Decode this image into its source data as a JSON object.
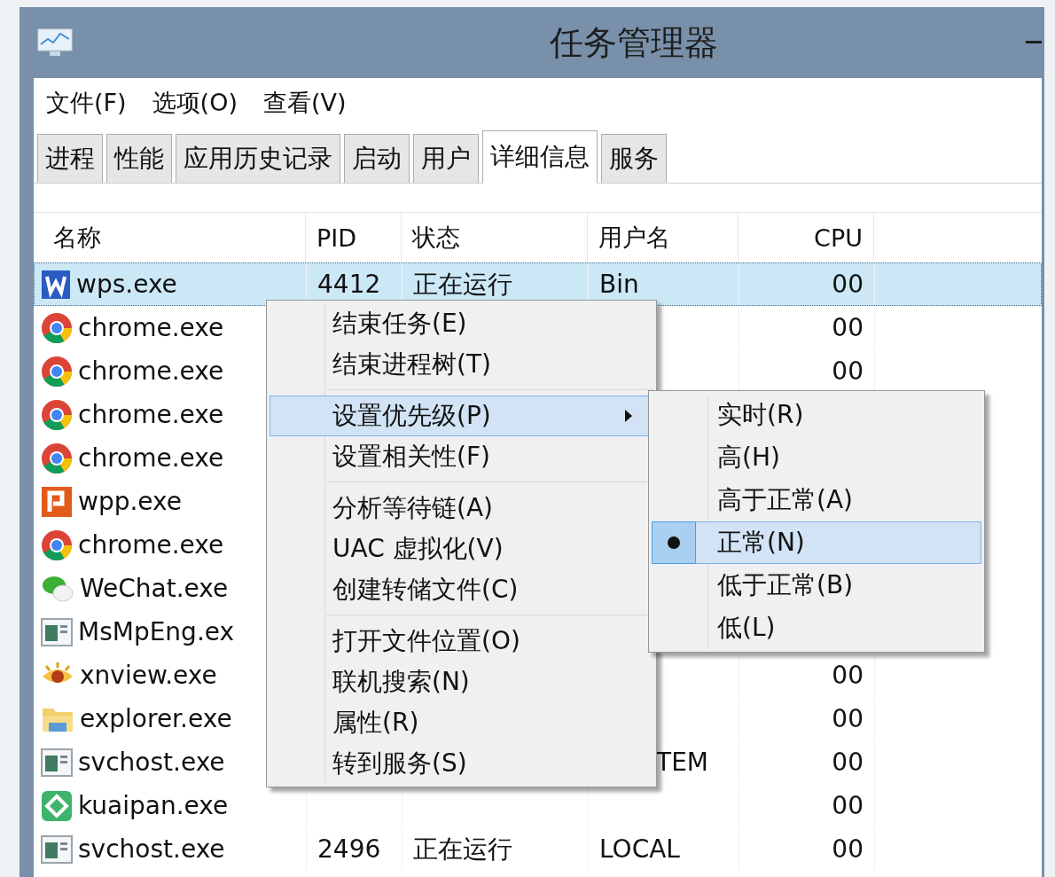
{
  "window": {
    "title": "任务管理器"
  },
  "menu_bar": [
    "文件(F)",
    "选项(O)",
    "查看(V)"
  ],
  "tabs": [
    {
      "label": "进程",
      "selected": false
    },
    {
      "label": "性能",
      "selected": false
    },
    {
      "label": "应用历史记录",
      "selected": false
    },
    {
      "label": "启动",
      "selected": false
    },
    {
      "label": "用户",
      "selected": false
    },
    {
      "label": "详细信息",
      "selected": true
    },
    {
      "label": "服务",
      "selected": false
    }
  ],
  "table": {
    "columns": [
      "名称",
      "PID",
      "状态",
      "用户名",
      "CPU"
    ],
    "rows": [
      {
        "kind": "doc",
        "name": "wps.exe",
        "pid": "4412",
        "status": "正在运行",
        "user": "Bin",
        "cpu": "00",
        "selected": true
      },
      {
        "kind": "browser",
        "name": "chrome.exe",
        "cpu": "00",
        "selected": false
      },
      {
        "kind": "browser",
        "name": "chrome.exe",
        "cpu": "00",
        "selected": false
      },
      {
        "kind": "browser",
        "name": "chrome.exe",
        "selected": false
      },
      {
        "kind": "browser",
        "name": "chrome.exe",
        "selected": false
      },
      {
        "kind": "slides",
        "name": "wpp.exe",
        "selected": false
      },
      {
        "kind": "browser",
        "name": "chrome.exe",
        "selected": false
      },
      {
        "kind": "chat",
        "name": "WeChat.exe",
        "selected": false
      },
      {
        "kind": "service",
        "name": "MsMpEng.ex",
        "selected": false
      },
      {
        "kind": "viewer",
        "name": "xnview.exe",
        "cpu": "00",
        "selected": false
      },
      {
        "kind": "folder",
        "name": "explorer.exe",
        "cpu": "00",
        "selected": false
      },
      {
        "kind": "service",
        "name": "svchost.exe",
        "user": "TEM",
        "user_clipped": true,
        "cpu": "00",
        "selected": false
      },
      {
        "kind": "cloud",
        "name": "kuaipan.exe",
        "cpu": "00",
        "selected": false
      },
      {
        "kind": "service",
        "name": "svchost.exe",
        "pid": "2496",
        "status": "正在运行",
        "user": "LOCAL",
        "cpu": "00",
        "selected": false
      }
    ]
  },
  "context_menu": {
    "groups": [
      [
        {
          "label": "结束任务(E)",
          "highlighted": false,
          "submenu": false
        },
        {
          "label": "结束进程树(T)",
          "highlighted": false,
          "submenu": false
        }
      ],
      [
        {
          "label": "设置优先级(P)",
          "highlighted": true,
          "submenu": true
        },
        {
          "label": "设置相关性(F)",
          "highlighted": false,
          "submenu": false
        }
      ],
      [
        {
          "label": "分析等待链(A)",
          "highlighted": false,
          "submenu": false
        },
        {
          "label": "UAC 虚拟化(V)",
          "highlighted": false,
          "submenu": false
        },
        {
          "label": "创建转储文件(C)",
          "highlighted": false,
          "submenu": false
        }
      ],
      [
        {
          "label": "打开文件位置(O)",
          "highlighted": false,
          "submenu": false
        },
        {
          "label": "联机搜索(N)",
          "highlighted": false,
          "submenu": false
        },
        {
          "label": "属性(R)",
          "highlighted": false,
          "submenu": false
        },
        {
          "label": "转到服务(S)",
          "highlighted": false,
          "submenu": false
        }
      ]
    ]
  },
  "submenu": {
    "items": [
      {
        "label": "实时(R)",
        "checked": false,
        "highlighted": false
      },
      {
        "label": "高(H)",
        "checked": false,
        "highlighted": false
      },
      {
        "label": "高于正常(A)",
        "checked": false,
        "highlighted": false
      },
      {
        "label": "正常(N)",
        "checked": true,
        "highlighted": true
      },
      {
        "label": "低于正常(B)",
        "checked": false,
        "highlighted": false
      },
      {
        "label": "低(L)",
        "checked": false,
        "highlighted": false
      }
    ]
  }
}
